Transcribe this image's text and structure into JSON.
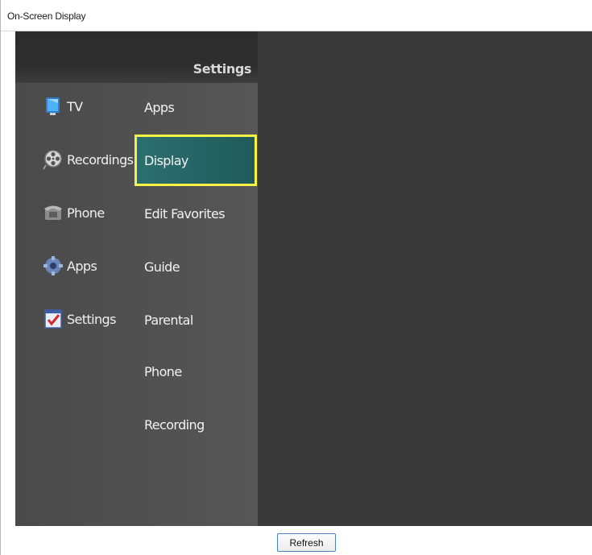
{
  "window": {
    "title": "On-Screen Display"
  },
  "osd": {
    "header": "Settings",
    "left_menu": [
      {
        "label": "TV",
        "icon": "tv-icon"
      },
      {
        "label": "Recordings",
        "icon": "film-reel-icon"
      },
      {
        "label": "Phone",
        "icon": "phone-icon"
      },
      {
        "label": "Apps",
        "icon": "gear-icon"
      },
      {
        "label": "Settings",
        "icon": "checklist-icon"
      }
    ],
    "right_menu": [
      {
        "label": "Apps",
        "selected": false
      },
      {
        "label": "Display",
        "selected": true
      },
      {
        "label": "Edit Favorites",
        "selected": false
      },
      {
        "label": "Guide",
        "selected": false
      },
      {
        "label": "Parental",
        "selected": false
      },
      {
        "label": "Phone",
        "selected": false
      },
      {
        "label": "Recording",
        "selected": false
      }
    ]
  },
  "footer": {
    "refresh_label": "Refresh"
  },
  "colors": {
    "menu_bg": "#565656",
    "content_bg": "#393939",
    "selection_fill": "#246464",
    "selection_border": "#f7f245"
  }
}
